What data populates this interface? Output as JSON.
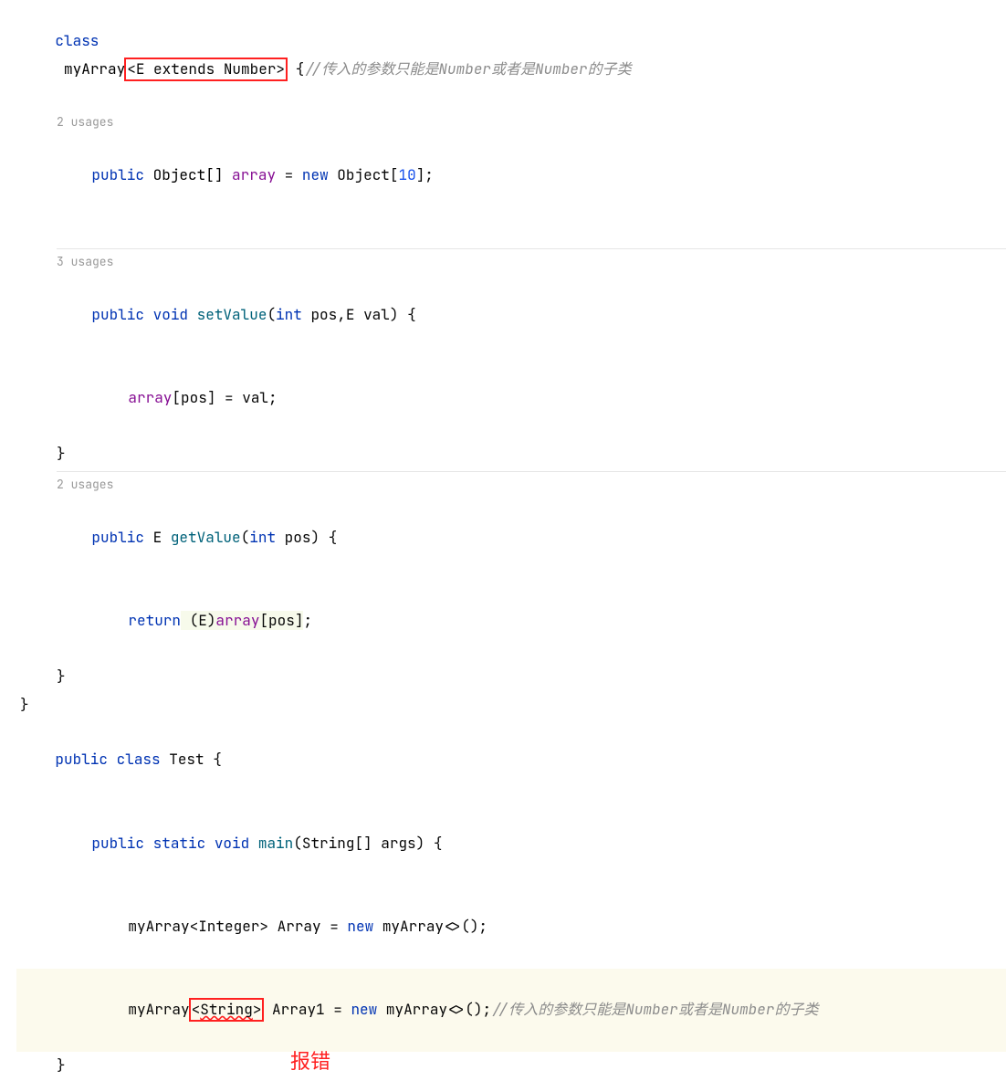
{
  "code": {
    "l1_class": "class",
    "l1_name": "myArray",
    "l1_generic": "<E extends Number>",
    "l1_brace": " {",
    "l1_comment": "//传入的参数只能是Number或者是Number的子类",
    "usages2": "2 usages",
    "l2_public": "public",
    "l2_type": "Object[]",
    "l2_field": "array",
    "l2_eq": " = ",
    "l2_new": "new",
    "l2_obj": " Object[",
    "l2_num": "10",
    "l2_end": "];",
    "usages3": "3 usages",
    "l3_public": "public",
    "l3_void": " void ",
    "l3_method": "setValue",
    "l3_params_open": "(",
    "l3_int": "int",
    "l3_pos": " pos,",
    "l3_E": "E",
    "l3_val": " val) {",
    "l4_arr": "array",
    "l4_idx": "[pos] = val;",
    "l5_close": "}",
    "usages2b": "2 usages",
    "l6_public": "public",
    "l6_E": " E ",
    "l6_method": "getValue",
    "l6_params": "(",
    "l6_int": "int",
    "l6_pos": " pos) {",
    "l7_return": "return",
    "l7_cast": " (E)",
    "l7_arr": "array",
    "l7_idx": "[pos]",
    "l7_semi": ";",
    "l8_close": "}",
    "l9_close": "}",
    "l10_public": "public",
    "l10_class": " class ",
    "l10_name": "Test {",
    "l11_public": "public",
    "l11_static": " static ",
    "l11_void": "void ",
    "l11_main": "main",
    "l11_params": "(String[] args) {",
    "l12_type": "myArray<Integer>",
    "l12_var": " Array = ",
    "l12_new": "new",
    "l12_ctor": " myArray<>();",
    "l13_type_pre": "myArray",
    "l13_generic_open": "<",
    "l13_string": "String",
    "l13_generic_close": ">",
    "l13_var": " Array1 = ",
    "l13_new": "new",
    "l13_ctor": " myArray<>();",
    "l13_comment": "//传入的参数只能是Number或者是Number的子类",
    "l14_close": "}",
    "error_label": "报错"
  }
}
